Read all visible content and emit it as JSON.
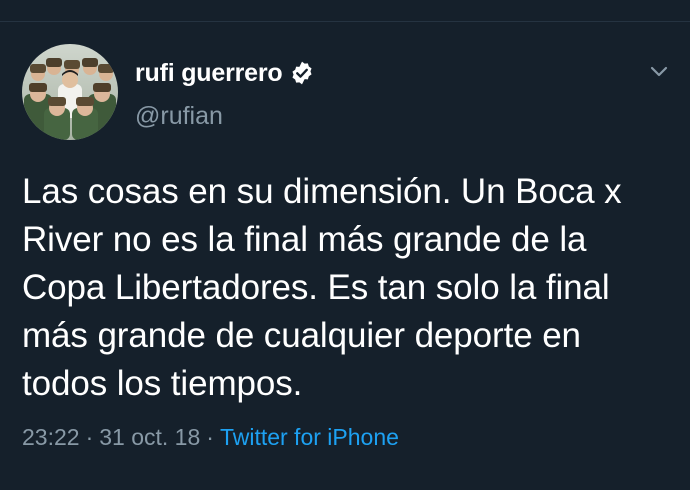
{
  "tweet": {
    "display_name": "rufi guerrero",
    "handle": "@rufian",
    "text": "Las cosas en su dimensión. Un Boca x River no es la final más grande de la Copa Libertadores. Es tan solo la final más grande de cualquier deporte en todos los tiempos.",
    "time": "23:22",
    "separator": "·",
    "date": "31 oct. 18",
    "source": "Twitter for iPhone"
  },
  "icons": {
    "verified": "verified-badge-icon",
    "menu": "chevron-down-icon"
  },
  "colors": {
    "background": "#15202b",
    "text": "#ffffff",
    "secondary": "#8899a6",
    "link": "#1da1f2"
  }
}
